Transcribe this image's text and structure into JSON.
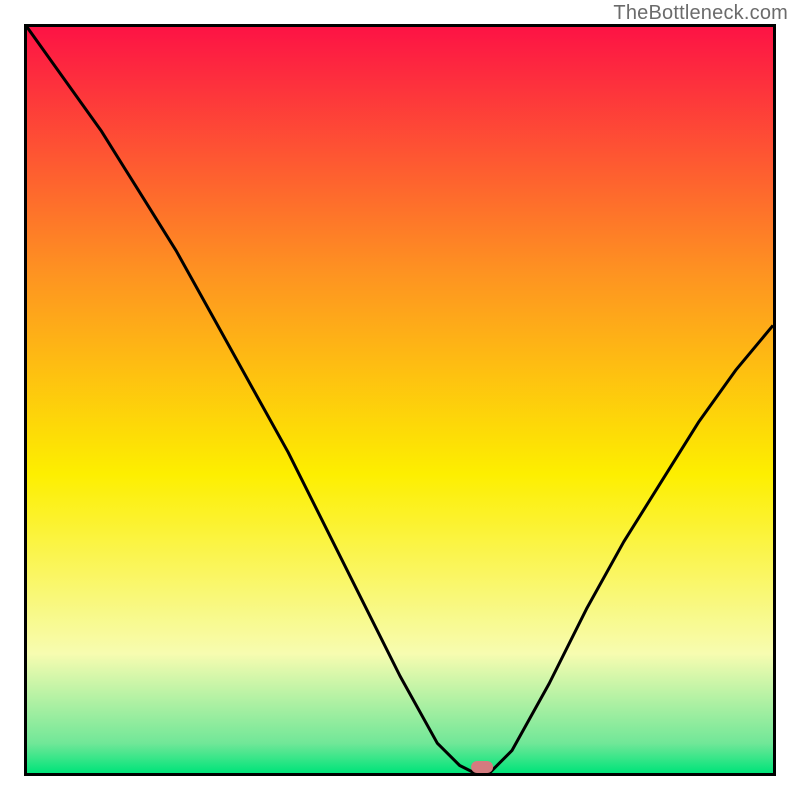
{
  "watermark": "TheBottleneck.com",
  "chart_data": {
    "type": "line",
    "title": "",
    "xlabel": "",
    "ylabel": "",
    "xlim": [
      0,
      100
    ],
    "ylim": [
      0,
      100
    ],
    "grid": false,
    "legend": false,
    "series": [
      {
        "name": "curve",
        "x": [
          0,
          5,
          10,
          15,
          20,
          25,
          30,
          35,
          40,
          45,
          50,
          55,
          58,
          60,
          62,
          65,
          70,
          75,
          80,
          85,
          90,
          95,
          100
        ],
        "y": [
          100,
          93,
          86,
          78,
          70,
          61,
          52,
          43,
          33,
          23,
          13,
          4,
          1,
          0,
          0,
          3,
          12,
          22,
          31,
          39,
          47,
          54,
          60
        ],
        "color": "#000000"
      }
    ],
    "marker": {
      "x": 61,
      "y": 0.8,
      "color": "#d47b7f",
      "shape": "rounded-rect"
    },
    "background_gradient": {
      "top": "#fd1345",
      "mid_upper": "#fe9321",
      "mid": "#fdef00",
      "mid_lower": "#f7fcb0",
      "lower": "#71e798",
      "bottom": "#00e47a"
    }
  }
}
